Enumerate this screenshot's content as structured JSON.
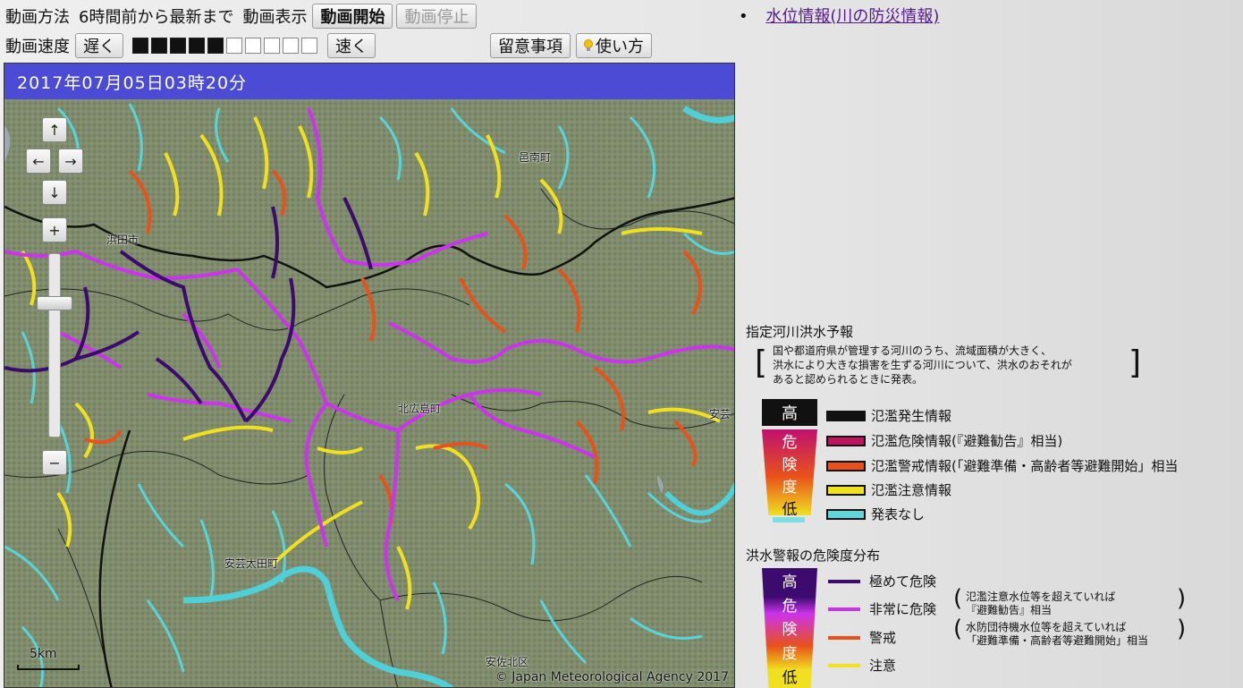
{
  "toolbar": {
    "method_label": "動画方法",
    "method_value": "6時間前から最新まで",
    "display_label": "動画表示",
    "start_button": "動画開始",
    "stop_button": "動画停止",
    "speed_label": "動画速度",
    "slow_button": "遅く",
    "fast_button": "速く",
    "speed_level": 5,
    "speed_max": 10,
    "notes_button": "留意事項",
    "howto_button": "使い方",
    "howto_icon": "lightbulb-icon"
  },
  "side": {
    "link": "水位情報(川の防災情報)"
  },
  "map": {
    "timestamp": "2017年07月05日03時20分",
    "controls": {
      "up": "↑",
      "left": "←",
      "right": "→",
      "down": "↓",
      "zoom_in": "+",
      "zoom_out": "−"
    },
    "zoom_level": 0.75,
    "places": [
      "邑南町",
      "浜田市",
      "北広島町",
      "安芸",
      "安芸太田町",
      "安佐北区"
    ],
    "scale": "5km",
    "credit": "© Japan Meteorological Agency 2017"
  },
  "legend": {
    "river_title": "指定河川洪水予報",
    "river_desc": [
      "国や都道府県が管理する河川のうち、流域面積が大きく、",
      "洪水により大きな損害を生ずる河川について、洪水のおそれが",
      "あると認められるときに発表。"
    ],
    "high": "高",
    "danger_chars": [
      "危",
      "険",
      "度",
      "低"
    ],
    "river_items": [
      {
        "label": "氾濫発生情報",
        "color": "#111111"
      },
      {
        "label": "氾濫危険情報(『避難勧告』相当)",
        "color": "#c0155e"
      },
      {
        "label": "氾濫警戒情報(「避難準備・高齢者等避難開始」相当",
        "color": "#e8521a"
      },
      {
        "label": "氾濫注意情報",
        "color": "#f0e020"
      },
      {
        "label": "発表なし",
        "color": "#5fd6dc"
      }
    ],
    "warn_title": "洪水警報の危険度分布",
    "warn_items": [
      {
        "label": "極めて危険",
        "color": "#3d0a6e"
      },
      {
        "label": "非常に危険",
        "color": "#cc33ee"
      },
      {
        "label": "警戒",
        "color": "#e8521a"
      },
      {
        "label": "注意",
        "color": "#f0e020"
      }
    ],
    "warn_note1": [
      "氾濫注意水位等を超えていれば",
      "『避難勧告』相当"
    ],
    "warn_note2": [
      "水防団待機水位等を超えていれば",
      "「避難準備・高齢者等避難開始」相当"
    ]
  }
}
